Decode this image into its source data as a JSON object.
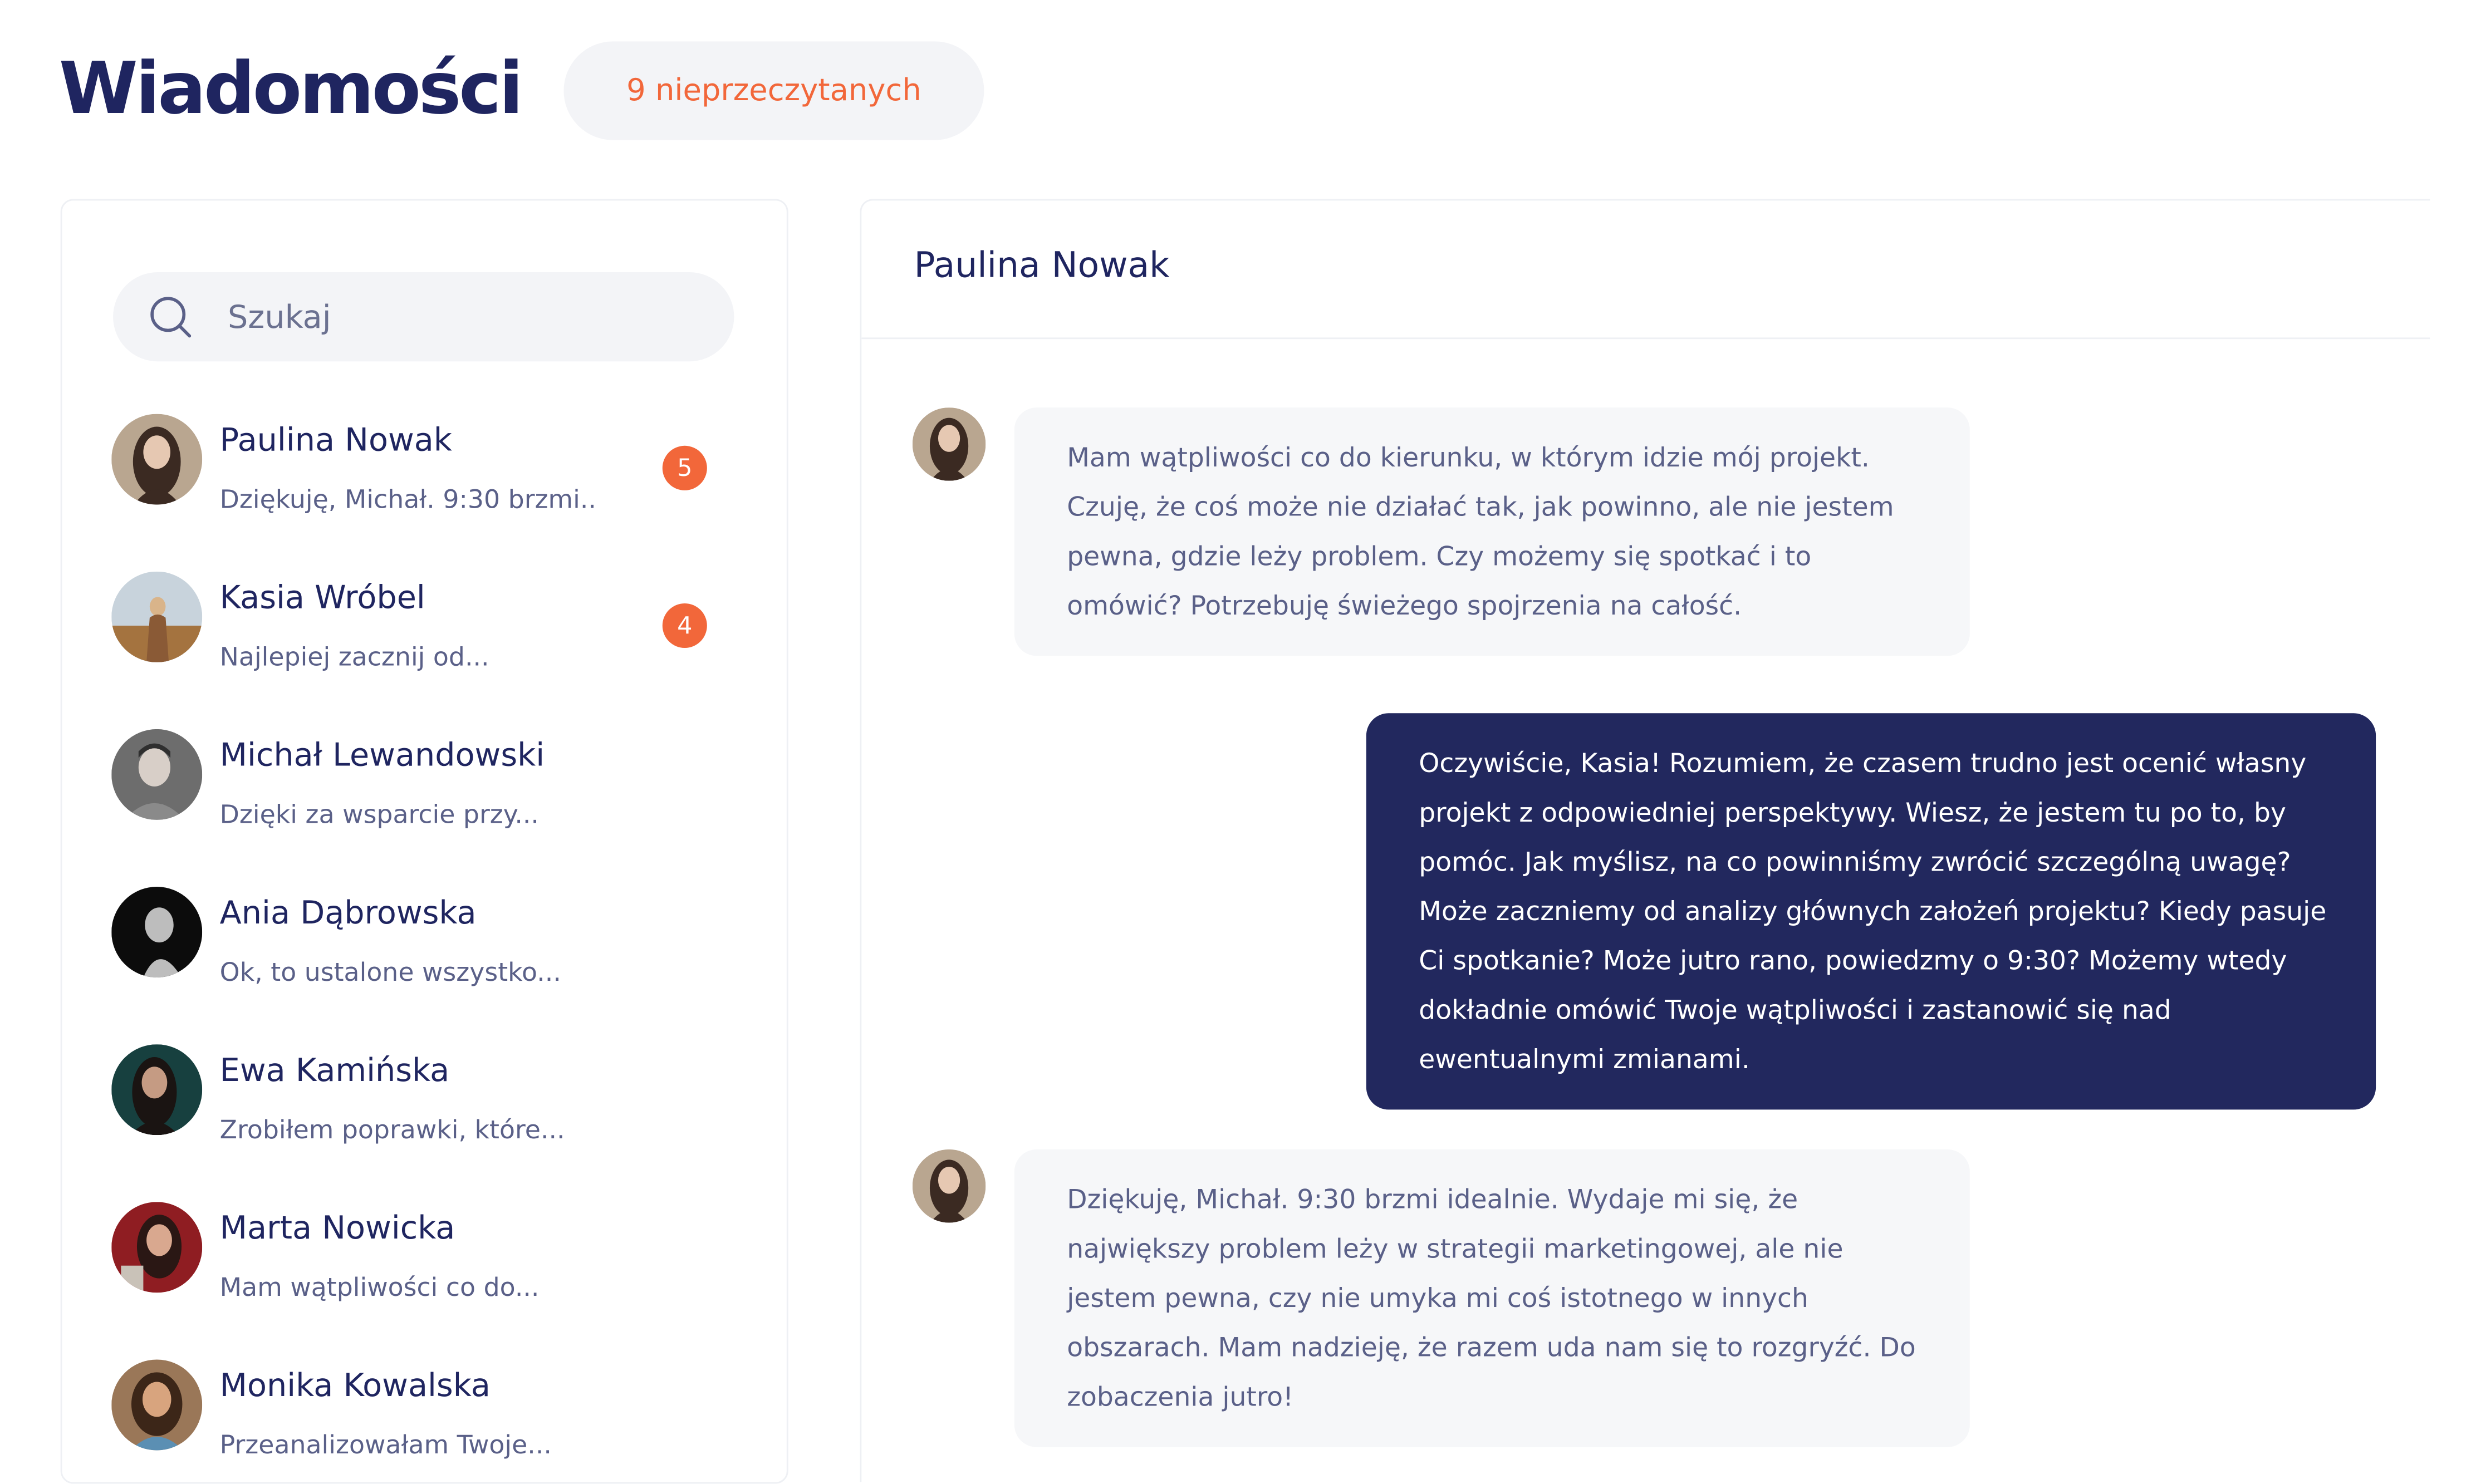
{
  "header": {
    "title": "Wiadomości",
    "unread_label": "9 nieprzeczytanych"
  },
  "search": {
    "placeholder": "Szukaj"
  },
  "contacts": [
    {
      "name": "Paulina Nowak",
      "preview": "Dziękuję, Michał. 9:30 brzmi..",
      "badge": "5",
      "avatar_colors": [
        "#b9a690",
        "#3b2a22",
        "#e6c8b2"
      ]
    },
    {
      "name": "Kasia Wróbel",
      "preview": "Najlepiej zacznij od...",
      "badge": "4",
      "avatar_colors": [
        "#c8d3dc",
        "#8a5a36",
        "#d9b48a"
      ]
    },
    {
      "name": "Michał Lewandowski",
      "preview": "Dzięki za wsparcie przy...",
      "badge": "",
      "avatar_colors": [
        "#6d6d6d",
        "#2f2f2f",
        "#d8cfc8"
      ]
    },
    {
      "name": "Ania Dąbrowska",
      "preview": "Ok, to ustalone wszystko...",
      "badge": "",
      "avatar_colors": [
        "#0c0c0c",
        "#111111",
        "#bdbdbd"
      ]
    },
    {
      "name": "Ewa Kamińska",
      "preview": "Zrobiłem poprawki, które...",
      "badge": "",
      "avatar_colors": [
        "#17403f",
        "#1a1412",
        "#c59b83"
      ]
    },
    {
      "name": "Marta Nowicka",
      "preview": "Mam wątpliwości co do...",
      "badge": "",
      "avatar_colors": [
        "#8f1d22",
        "#2a1714",
        "#d9a88f"
      ]
    },
    {
      "name": "Monika Kowalska",
      "preview": "Przeanalizowałam Twoje...",
      "badge": "",
      "avatar_colors": [
        "#9a7758",
        "#3c2618",
        "#d8a47e"
      ]
    }
  ],
  "chat": {
    "title": "Paulina Nowak",
    "messages": [
      {
        "direction": "in",
        "text": "Mam wątpliwości co do kierunku, w którym idzie mój projekt. Czuję, że coś może nie działać tak, jak powinno, ale nie jestem pewna, gdzie leży problem. Czy możemy się spotkać i to omówić? Potrzebuję świeżego spojrzenia na całość."
      },
      {
        "direction": "out",
        "text": "Oczywiście, Kasia! Rozumiem, że czasem trudno jest ocenić własny projekt z odpowiedniej perspektywy. Wiesz, że jestem tu po to, by pomóc. Jak myślisz, na co powinniśmy zwrócić szczególną uwagę? Może zaczniemy od analizy głównych założeń projektu? Kiedy pasuje Ci spotkanie? Może jutro rano, powiedzmy o 9:30? Możemy wtedy dokładnie omówić Twoje wątpliwości i zastanowić się nad ewentualnymi zmianami."
      },
      {
        "direction": "in",
        "text": "Dziękuję, Michał. 9:30 brzmi idealnie. Wydaje mi się, że największy problem leży w strategii marketingowej, ale nie jestem pewna, czy nie umyka mi coś istotnego w innych obszarach. Mam nadzieję, że razem uda nam się to rozgryźć. Do zobaczenia jutro!"
      }
    ]
  },
  "colors": {
    "navy": "#22285e",
    "accent": "#f2673a",
    "bubble_in": "#f6f7f9"
  }
}
